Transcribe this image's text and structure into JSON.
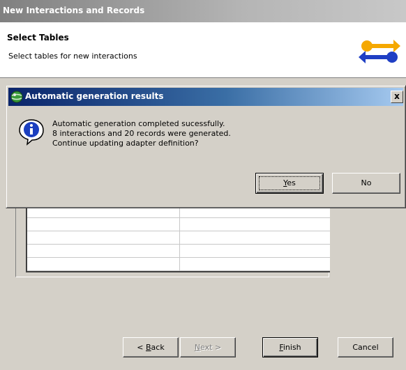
{
  "wizard": {
    "title": "New Interactions and Records",
    "heading": "Select Tables",
    "description": "Select tables for new interactions",
    "logo_icon": "connector-arrows-icon",
    "buttons": {
      "back": {
        "prefix": "< ",
        "mnemonic": "B",
        "rest": "ack"
      },
      "next": {
        "mnemonic": "N",
        "rest": "ext >"
      },
      "finish": {
        "mnemonic": "F",
        "rest": "inish"
      },
      "cancel": "Cancel"
    },
    "table_rows": 5
  },
  "dialog": {
    "title": "Automatic generation results",
    "title_icon": "app-globe-icon",
    "close_label": "x",
    "info_icon": "info-icon",
    "message_lines": [
      "Automatic generation completed sucessfully.",
      "8 interactions and 20 records were generated.",
      "Continue updating adapter definition?"
    ],
    "buttons": {
      "yes": {
        "mnemonic": "Y",
        "rest": "es"
      },
      "no": "No"
    }
  },
  "colors": {
    "dialog_title_gradient_start": "#0a246a",
    "dialog_title_gradient_end": "#a6caf0",
    "face": "#d4d0c8"
  }
}
